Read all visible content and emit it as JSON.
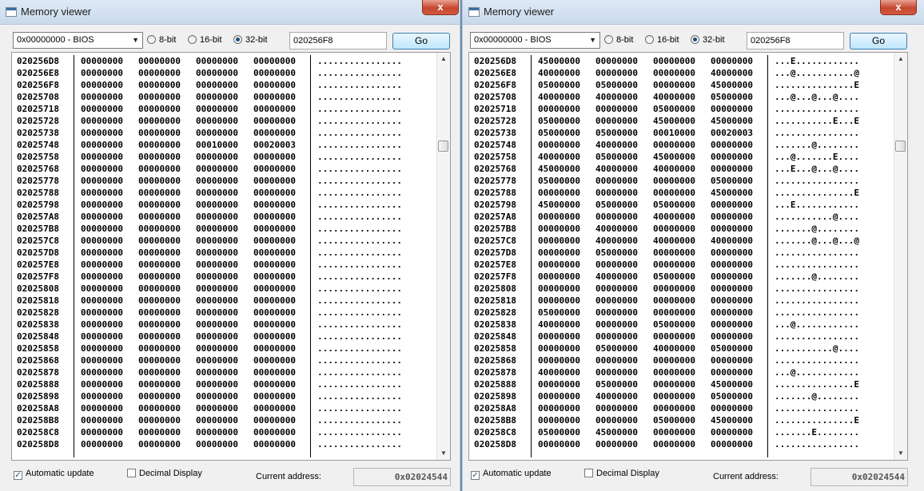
{
  "windows": [
    {
      "title": "Memory viewer",
      "close_label": "x",
      "region": "0x00000000 - BIOS",
      "radio_8": "8-bit",
      "radio_16": "16-bit",
      "radio_32": "32-bit",
      "address": "020256F8",
      "go": "Go",
      "auto_update": "Automatic update",
      "decimal_display": "Decimal Display",
      "current_address_label": "Current address:",
      "current_address": "0x02024544",
      "rows": [
        [
          "020256D8",
          "00000000",
          "00000000",
          "00000000",
          "00000000",
          "................"
        ],
        [
          "020256E8",
          "00000000",
          "00000000",
          "00000000",
          "00000000",
          "................"
        ],
        [
          "020256F8",
          "00000000",
          "00000000",
          "00000000",
          "00000000",
          "................"
        ],
        [
          "02025708",
          "00000000",
          "00000000",
          "00000000",
          "00000000",
          "................"
        ],
        [
          "02025718",
          "00000000",
          "00000000",
          "00000000",
          "00000000",
          "................"
        ],
        [
          "02025728",
          "00000000",
          "00000000",
          "00000000",
          "00000000",
          "................"
        ],
        [
          "02025738",
          "00000000",
          "00000000",
          "00000000",
          "00000000",
          "................"
        ],
        [
          "02025748",
          "00000000",
          "00000000",
          "00010000",
          "00020003",
          "................"
        ],
        [
          "02025758",
          "00000000",
          "00000000",
          "00000000",
          "00000000",
          "................"
        ],
        [
          "02025768",
          "00000000",
          "00000000",
          "00000000",
          "00000000",
          "................"
        ],
        [
          "02025778",
          "00000000",
          "00000000",
          "00000000",
          "00000000",
          "................"
        ],
        [
          "02025788",
          "00000000",
          "00000000",
          "00000000",
          "00000000",
          "................"
        ],
        [
          "02025798",
          "00000000",
          "00000000",
          "00000000",
          "00000000",
          "................"
        ],
        [
          "020257A8",
          "00000000",
          "00000000",
          "00000000",
          "00000000",
          "................"
        ],
        [
          "020257B8",
          "00000000",
          "00000000",
          "00000000",
          "00000000",
          "................"
        ],
        [
          "020257C8",
          "00000000",
          "00000000",
          "00000000",
          "00000000",
          "................"
        ],
        [
          "020257D8",
          "00000000",
          "00000000",
          "00000000",
          "00000000",
          "................"
        ],
        [
          "020257E8",
          "00000000",
          "00000000",
          "00000000",
          "00000000",
          "................"
        ],
        [
          "020257F8",
          "00000000",
          "00000000",
          "00000000",
          "00000000",
          "................"
        ],
        [
          "02025808",
          "00000000",
          "00000000",
          "00000000",
          "00000000",
          "................"
        ],
        [
          "02025818",
          "00000000",
          "00000000",
          "00000000",
          "00000000",
          "................"
        ],
        [
          "02025828",
          "00000000",
          "00000000",
          "00000000",
          "00000000",
          "................"
        ],
        [
          "02025838",
          "00000000",
          "00000000",
          "00000000",
          "00000000",
          "................"
        ],
        [
          "02025848",
          "00000000",
          "00000000",
          "00000000",
          "00000000",
          "................"
        ],
        [
          "02025858",
          "00000000",
          "00000000",
          "00000000",
          "00000000",
          "................"
        ],
        [
          "02025868",
          "00000000",
          "00000000",
          "00000000",
          "00000000",
          "................"
        ],
        [
          "02025878",
          "00000000",
          "00000000",
          "00000000",
          "00000000",
          "................"
        ],
        [
          "02025888",
          "00000000",
          "00000000",
          "00000000",
          "00000000",
          "................"
        ],
        [
          "02025898",
          "00000000",
          "00000000",
          "00000000",
          "00000000",
          "................"
        ],
        [
          "020258A8",
          "00000000",
          "00000000",
          "00000000",
          "00000000",
          "................"
        ],
        [
          "020258B8",
          "00000000",
          "00000000",
          "00000000",
          "00000000",
          "................"
        ],
        [
          "020258C8",
          "00000000",
          "00000000",
          "00000000",
          "00000000",
          "................"
        ],
        [
          "020258D8",
          "00000000",
          "00000000",
          "00000000",
          "00000000",
          "................"
        ]
      ]
    },
    {
      "title": "Memory viewer",
      "close_label": "x",
      "region": "0x00000000 - BIOS",
      "radio_8": "8-bit",
      "radio_16": "16-bit",
      "radio_32": "32-bit",
      "address": "020256F8",
      "go": "Go",
      "auto_update": "Automatic update",
      "decimal_display": "Decimal Display",
      "current_address_label": "Current address:",
      "current_address": "0x02024544",
      "rows": [
        [
          "020256D8",
          "45000000",
          "00000000",
          "00000000",
          "00000000",
          "...E............"
        ],
        [
          "020256E8",
          "40000000",
          "00000000",
          "00000000",
          "40000000",
          "...@...........@"
        ],
        [
          "020256F8",
          "05000000",
          "05000000",
          "00000000",
          "45000000",
          "...............E"
        ],
        [
          "02025708",
          "40000000",
          "40000000",
          "40000000",
          "05000000",
          "...@...@...@...."
        ],
        [
          "02025718",
          "00000000",
          "00000000",
          "05000000",
          "00000000",
          "................"
        ],
        [
          "02025728",
          "05000000",
          "00000000",
          "45000000",
          "45000000",
          "...........E...E"
        ],
        [
          "02025738",
          "05000000",
          "05000000",
          "00010000",
          "00020003",
          "................"
        ],
        [
          "02025748",
          "00000000",
          "40000000",
          "00000000",
          "00000000",
          ".......@........"
        ],
        [
          "02025758",
          "40000000",
          "05000000",
          "45000000",
          "00000000",
          "...@.......E...."
        ],
        [
          "02025768",
          "45000000",
          "40000000",
          "40000000",
          "00000000",
          "...E...@...@...."
        ],
        [
          "02025778",
          "05000000",
          "00000000",
          "00000000",
          "05000000",
          "................"
        ],
        [
          "02025788",
          "00000000",
          "00000000",
          "00000000",
          "45000000",
          "...............E"
        ],
        [
          "02025798",
          "45000000",
          "05000000",
          "05000000",
          "00000000",
          "...E............"
        ],
        [
          "020257A8",
          "00000000",
          "00000000",
          "40000000",
          "00000000",
          "...........@...."
        ],
        [
          "020257B8",
          "00000000",
          "40000000",
          "00000000",
          "00000000",
          ".......@........"
        ],
        [
          "020257C8",
          "00000000",
          "40000000",
          "40000000",
          "40000000",
          ".......@...@...@"
        ],
        [
          "020257D8",
          "00000000",
          "05000000",
          "00000000",
          "00000000",
          "................"
        ],
        [
          "020257E8",
          "00000000",
          "00000000",
          "00000000",
          "00000000",
          "................"
        ],
        [
          "020257F8",
          "00000000",
          "40000000",
          "05000000",
          "00000000",
          ".......@........"
        ],
        [
          "02025808",
          "00000000",
          "00000000",
          "00000000",
          "00000000",
          "................"
        ],
        [
          "02025818",
          "00000000",
          "00000000",
          "00000000",
          "00000000",
          "................"
        ],
        [
          "02025828",
          "05000000",
          "00000000",
          "00000000",
          "00000000",
          "................"
        ],
        [
          "02025838",
          "40000000",
          "00000000",
          "05000000",
          "00000000",
          "...@............"
        ],
        [
          "02025848",
          "00000000",
          "00000000",
          "00000000",
          "00000000",
          "................"
        ],
        [
          "02025858",
          "00000000",
          "05000000",
          "40000000",
          "05000000",
          "...........@...."
        ],
        [
          "02025868",
          "00000000",
          "00000000",
          "00000000",
          "00000000",
          "................"
        ],
        [
          "02025878",
          "40000000",
          "00000000",
          "00000000",
          "00000000",
          "...@............"
        ],
        [
          "02025888",
          "00000000",
          "05000000",
          "00000000",
          "45000000",
          "...............E"
        ],
        [
          "02025898",
          "00000000",
          "40000000",
          "00000000",
          "05000000",
          ".......@........"
        ],
        [
          "020258A8",
          "00000000",
          "00000000",
          "00000000",
          "00000000",
          "................"
        ],
        [
          "020258B8",
          "00000000",
          "00000000",
          "05000000",
          "45000000",
          "...............E"
        ],
        [
          "020258C8",
          "05000000",
          "45000000",
          "00000000",
          "00000000",
          ".......E........"
        ],
        [
          "020258D8",
          "00000000",
          "00000000",
          "00000000",
          "00000000",
          "................"
        ]
      ]
    }
  ]
}
